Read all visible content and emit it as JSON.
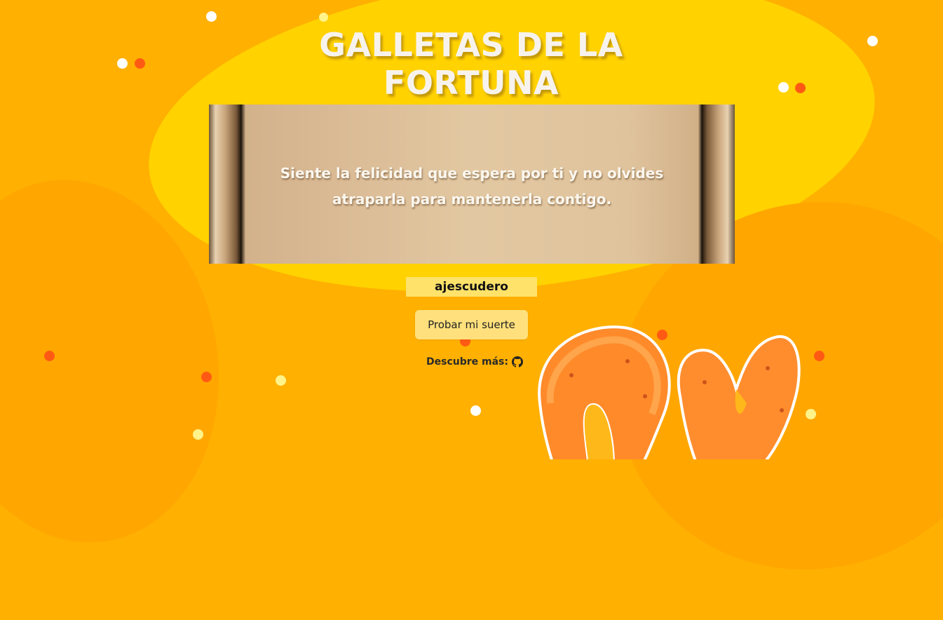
{
  "header": {
    "title": "GALLETAS DE LA FORTUNA"
  },
  "fortune": {
    "message": "Siente la felicidad que espera por ti y no olvides atraparla para mantenerla contigo."
  },
  "user": {
    "name": "ajescudero"
  },
  "actions": {
    "try_luck_label": "Probar mi suerte"
  },
  "footer": {
    "discover_label": "Descubre más:",
    "link_icon": "github-icon"
  },
  "illustration": {
    "name": "fortune-cookies"
  },
  "colors": {
    "background": "#ffb000",
    "blob": "#ffd200",
    "title": "#f7f3ec",
    "button": "#ffe07c",
    "chip": "#ffe26a",
    "dot_red": "#ff5a14",
    "dot_white": "#ffffff",
    "dot_yellow": "#fff38a"
  }
}
